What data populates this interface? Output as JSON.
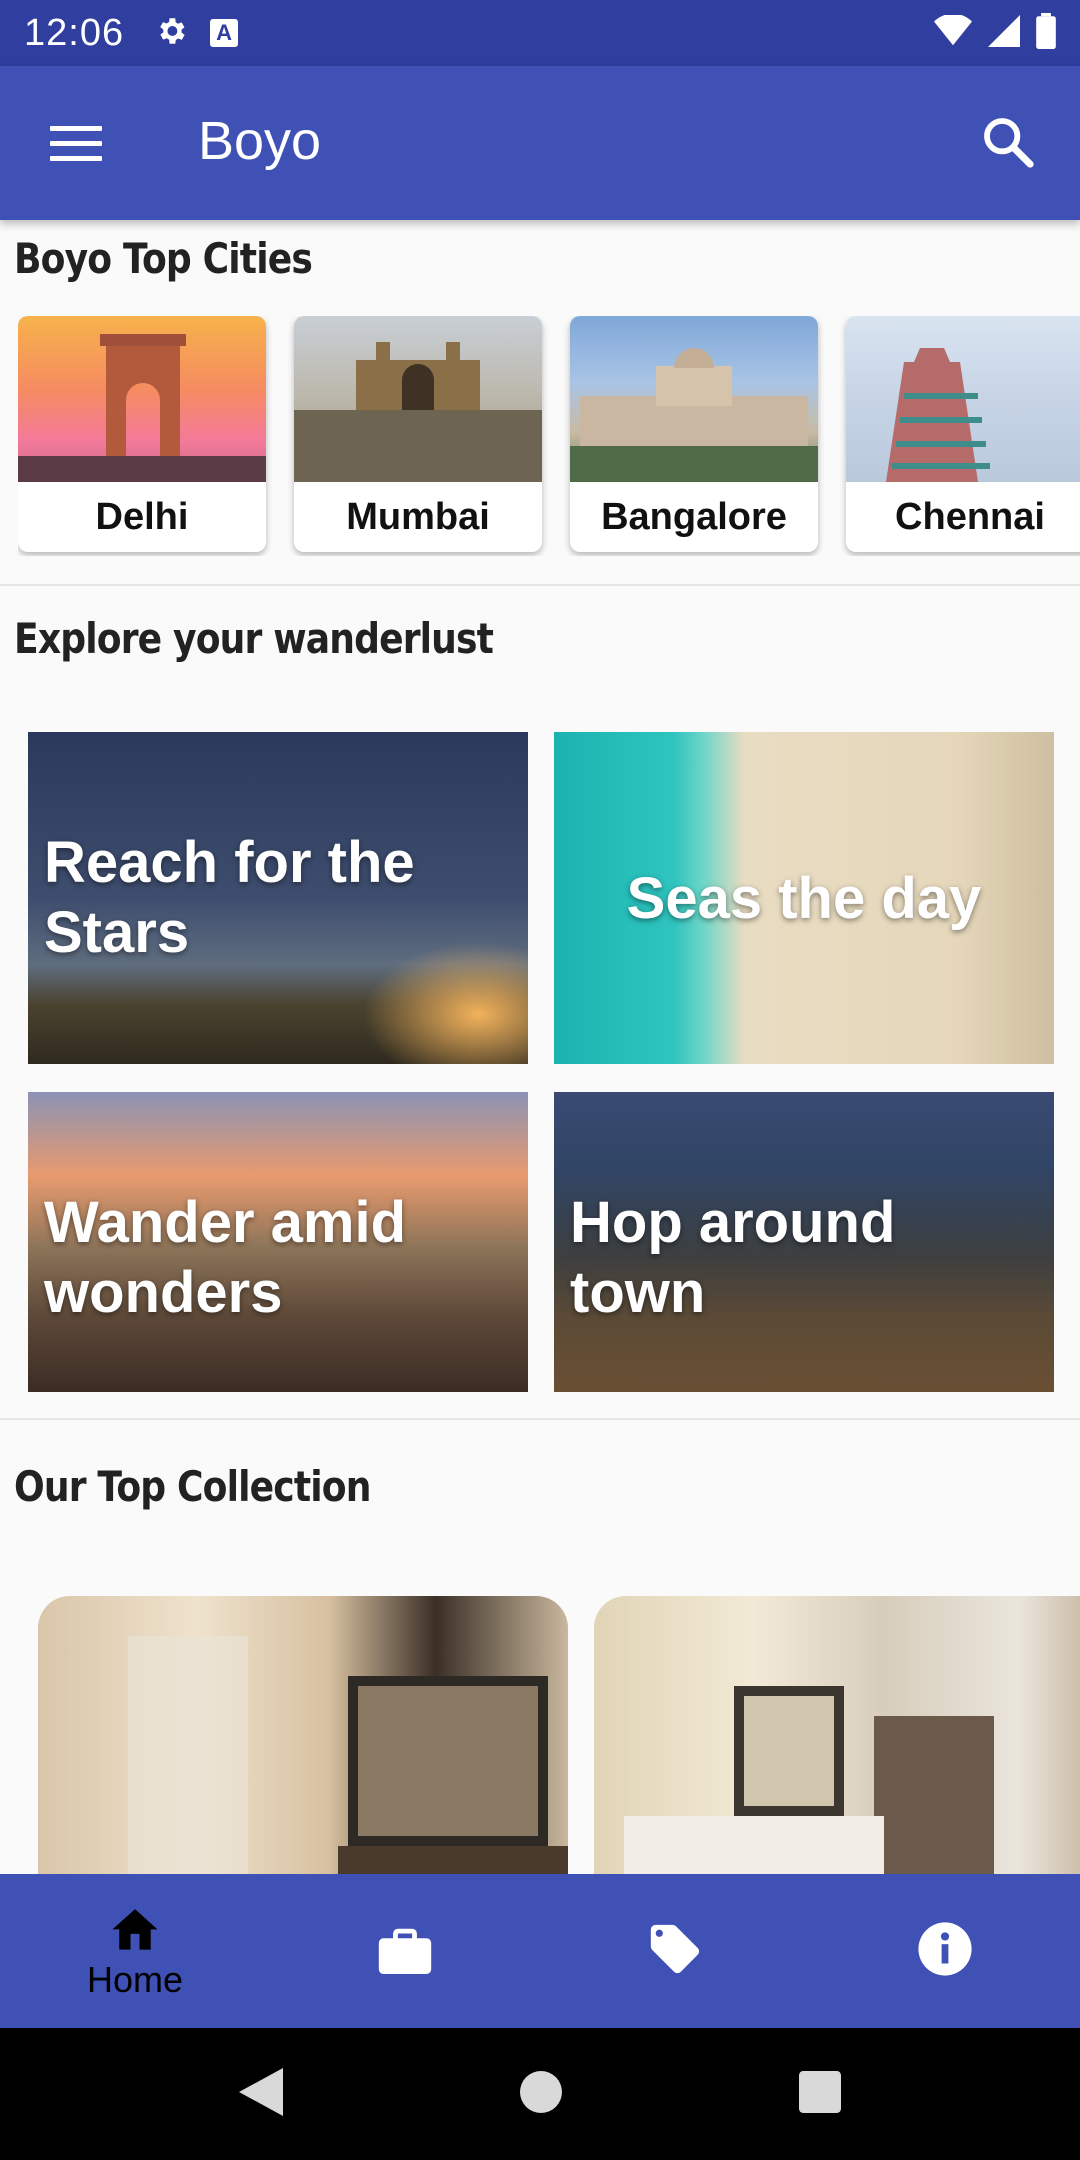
{
  "status_bar": {
    "time": "12:06",
    "icons": [
      "gear-icon",
      "a-icon",
      "wifi-icon",
      "signal-icon",
      "battery-icon"
    ]
  },
  "app_bar": {
    "title": "Boyo",
    "menu_icon": "menu-icon",
    "search_icon": "search-icon"
  },
  "top_cities": {
    "title": "Boyo Top Cities",
    "cities": [
      {
        "label": "Delhi"
      },
      {
        "label": "Mumbai"
      },
      {
        "label": "Bangalore"
      },
      {
        "label": "Chennai"
      }
    ]
  },
  "wanderlust": {
    "title": "Explore your wanderlust",
    "tiles": [
      {
        "label": "Reach for the Stars"
      },
      {
        "label": "Seas the day"
      },
      {
        "label": "Wander amid wonders"
      },
      {
        "label": "Hop around town"
      }
    ]
  },
  "collection": {
    "title": "Our Top Collection"
  },
  "bottom_nav": {
    "items": [
      {
        "label": "Home",
        "icon": "home-icon"
      },
      {
        "icon": "briefcase-icon"
      },
      {
        "icon": "tag-icon"
      },
      {
        "icon": "info-icon"
      }
    ]
  },
  "colors": {
    "status_bar": "#303f9f",
    "app_bar": "#3f51b5",
    "background": "#fafafa"
  }
}
